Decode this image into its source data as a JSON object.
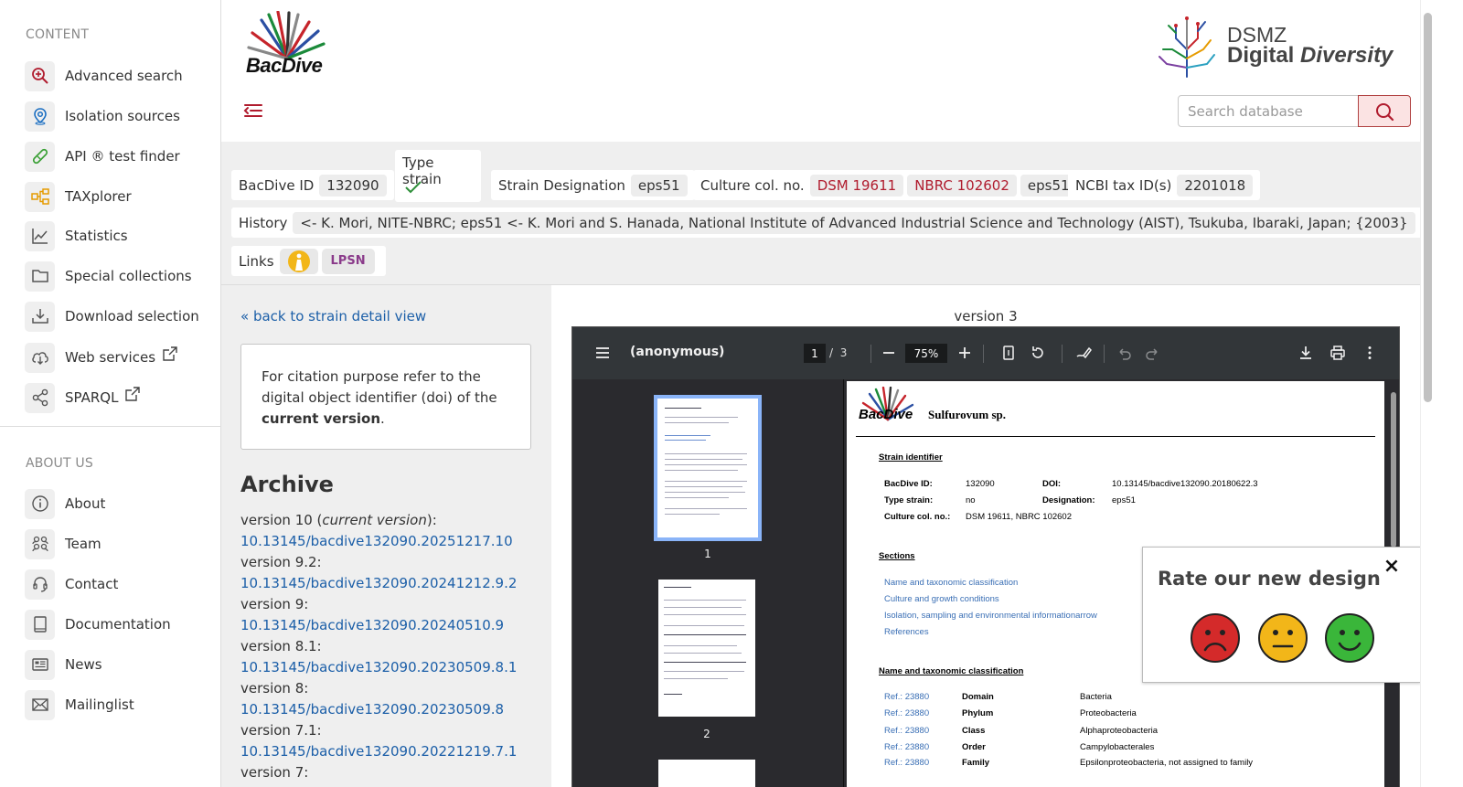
{
  "sidebar": {
    "content_heading": "CONTENT",
    "content_items": [
      {
        "label": "Advanced search",
        "icon": "magnify-plus-icon"
      },
      {
        "label": "Isolation sources",
        "icon": "location-pin-icon"
      },
      {
        "label": "API ® test finder",
        "icon": "test-tube-icon"
      },
      {
        "label": "TAXplorer",
        "icon": "hierarchy-icon"
      },
      {
        "label": "Statistics",
        "icon": "line-chart-icon"
      },
      {
        "label": "Special collections",
        "icon": "folder-icon"
      },
      {
        "label": "Download selection",
        "icon": "download-tray-icon"
      },
      {
        "label": "Web services",
        "icon": "cloud-download-icon"
      },
      {
        "label": "SPARQL",
        "icon": "share-nodes-icon"
      }
    ],
    "about_heading": "ABOUT US",
    "about_items": [
      {
        "label": "About",
        "icon": "info-icon"
      },
      {
        "label": "Team",
        "icon": "team-icon"
      },
      {
        "label": "Contact",
        "icon": "headset-icon"
      },
      {
        "label": "Documentation",
        "icon": "book-icon"
      },
      {
        "label": "News",
        "icon": "newspaper-icon"
      },
      {
        "label": "Mailinglist",
        "icon": "envelope-icon"
      }
    ]
  },
  "header": {
    "logo_text": "BacDive",
    "dsmz_line1": "DSMZ",
    "dsmz_line2a": "Digital",
    "dsmz_line2b": "Diversity",
    "search_placeholder": "Search database",
    "accent_color": "#b01c2e"
  },
  "strain": {
    "bacdive_id_label": "BacDive ID",
    "bacdive_id": "132090",
    "type_strain_label": "Type strain",
    "type_strain_value": "check-icon",
    "designation_label": "Strain Designation",
    "designation": "eps51",
    "culture_label": "Culture col. no.",
    "culture_nos": [
      "DSM 19611",
      "NBRC 102602",
      "eps51"
    ],
    "ncbi_label": "NCBI tax ID(s)",
    "ncbi_id": "2201018",
    "history_label": "History",
    "history": "<- K. Mori, NITE-NBRC; eps51 <- K. Mori and S. Hanada, National Institute of Advanced Industrial Science and Technology (AIST), Tsukuba, Ibaraki, Japan; {2003}",
    "links_label": "Links",
    "lpsn_label": "LPSN"
  },
  "archive": {
    "back_link": "« back to strain detail view",
    "citation_pre": "For citation purpose refer to the digital object identifier (doi) of the ",
    "citation_bold": "current version",
    "citation_post": ".",
    "title": "Archive",
    "versions": [
      {
        "label": "version 10 (",
        "italic": "current version",
        "suffix": "):",
        "doi": "10.13145/bacdive132090.20251217.10"
      },
      {
        "label": "version 9.2:",
        "italic": "",
        "suffix": "",
        "doi": "10.13145/bacdive132090.20241212.9.2"
      },
      {
        "label": "version 9:",
        "italic": "",
        "suffix": "",
        "doi": "10.13145/bacdive132090.20240510.9"
      },
      {
        "label": "version 8.1:",
        "italic": "",
        "suffix": "",
        "doi": "10.13145/bacdive132090.20230509.8.1"
      },
      {
        "label": "version 8:",
        "italic": "",
        "suffix": "",
        "doi": "10.13145/bacdive132090.20230509.8"
      },
      {
        "label": "version 7.1:",
        "italic": "",
        "suffix": "",
        "doi": "10.13145/bacdive132090.20221219.7.1"
      },
      {
        "label": "version 7:",
        "italic": "",
        "suffix": "",
        "doi": ""
      }
    ]
  },
  "viewer": {
    "version_title": "version 3",
    "doc_title": "(anonymous)",
    "page_current": "1",
    "page_sep": "/",
    "page_total": "3",
    "zoom": "75%",
    "thumb_labels": [
      "1",
      "2"
    ],
    "page": {
      "logo_text": "BacDive",
      "organism": "Sulfurovum sp.",
      "strain_identifier_heading": "Strain identifier",
      "fields": {
        "bacdive_id_label": "BacDive ID:",
        "bacdive_id": "132090",
        "doi_label": "DOI:",
        "doi": "10.13145/bacdive132090.20180622.3",
        "type_strain_label": "Type strain:",
        "type_strain": "no",
        "designation_label": "Designation:",
        "designation": "eps51",
        "culture_label": "Culture col. no.:",
        "culture": "DSM 19611, NBRC 102602"
      },
      "sections_heading": "Sections",
      "sections": [
        "Name and taxonomic classification",
        "Culture and growth conditions",
        "Isolation, sampling and environmental informationarrow",
        "References"
      ],
      "taxonomy_heading": "Name and taxonomic classification",
      "taxonomy": [
        {
          "ref": "Ref.: 23880",
          "rank": "Domain",
          "value": "Bacteria"
        },
        {
          "ref": "Ref.: 23880",
          "rank": "Phylum",
          "value": "Proteobacteria"
        },
        {
          "ref": "Ref.: 23880",
          "rank": "Class",
          "value": "Alphaproteobacteria"
        },
        {
          "ref": "Ref.: 23880",
          "rank": "Order",
          "value": "Campylobacterales"
        },
        {
          "ref": "Ref.: 23880",
          "rank": "Family",
          "value": "Epsilonproteobacteria, not assigned to family"
        }
      ]
    }
  },
  "rating": {
    "title": "Rate our new design",
    "close": "×",
    "faces": [
      "sad-face-icon",
      "neutral-face-icon",
      "happy-face-icon"
    ],
    "colors": {
      "sad": "#d42a2a",
      "neutral": "#f2b619",
      "happy": "#3ab63a"
    }
  }
}
